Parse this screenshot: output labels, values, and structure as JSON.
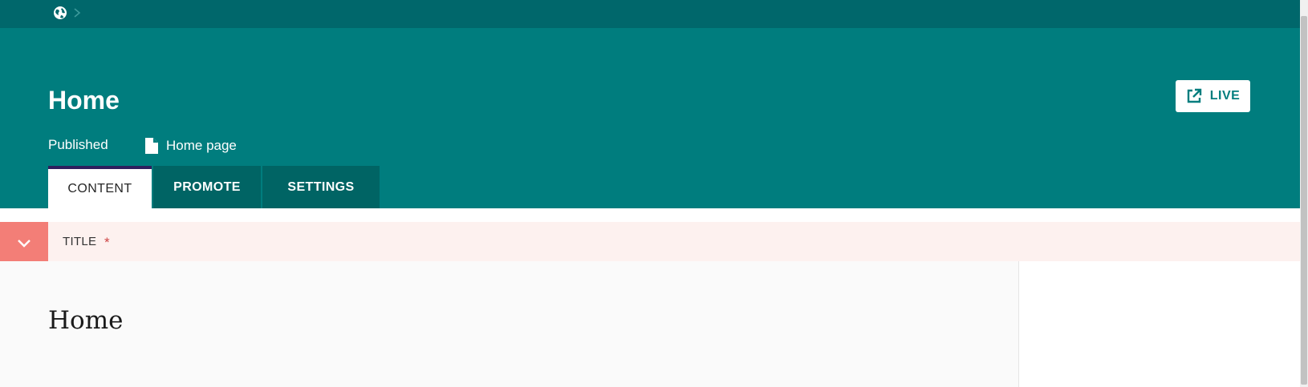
{
  "breadcrumb": {
    "root_icon": "globe-icon",
    "separator_icon": "chevron-right-icon"
  },
  "header": {
    "title": "Home",
    "status": "Published",
    "page_type": "Home page",
    "page_type_icon": "document-icon",
    "live_button": {
      "label": "LIVE",
      "icon": "external-link-icon"
    }
  },
  "tabs": [
    {
      "label": "CONTENT",
      "active": true
    },
    {
      "label": "PROMOTE",
      "active": false
    },
    {
      "label": "SETTINGS",
      "active": false
    }
  ],
  "field": {
    "label": "TITLE",
    "required_marker": "*",
    "toggle_icon": "chevron-down-icon",
    "value": "Home"
  },
  "colors": {
    "topbar": "#00676b",
    "header": "#007d7e",
    "tab_inactive": "#006464",
    "tab_active_border": "#2e1f5e",
    "field_row": "#fdf1ef",
    "toggle": "#f37e77",
    "required": "#cd4444"
  }
}
